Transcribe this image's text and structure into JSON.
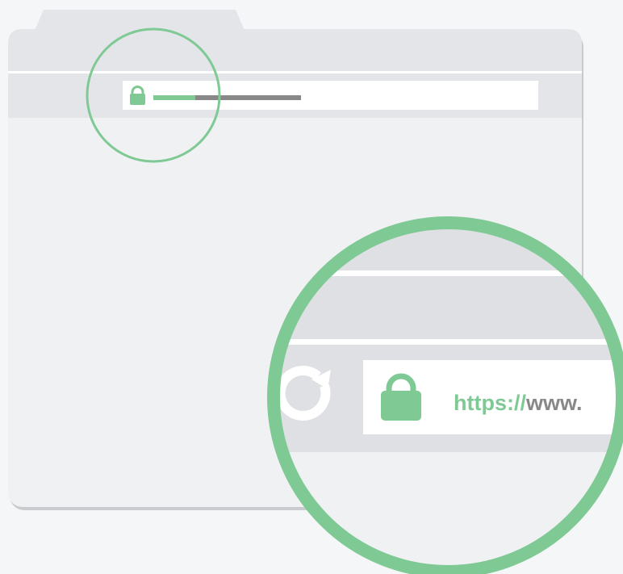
{
  "illustration": {
    "zoom": {
      "url_scheme": "https://",
      "url_host": "www."
    }
  },
  "colors": {
    "accent_green": "#7ec994",
    "url_gray": "#888888",
    "window_fill": "#f0f1f3",
    "bar_fill": "#dfe0e3",
    "background": "#f5f6f8"
  },
  "icons": [
    "lock-icon",
    "reload-icon"
  ]
}
